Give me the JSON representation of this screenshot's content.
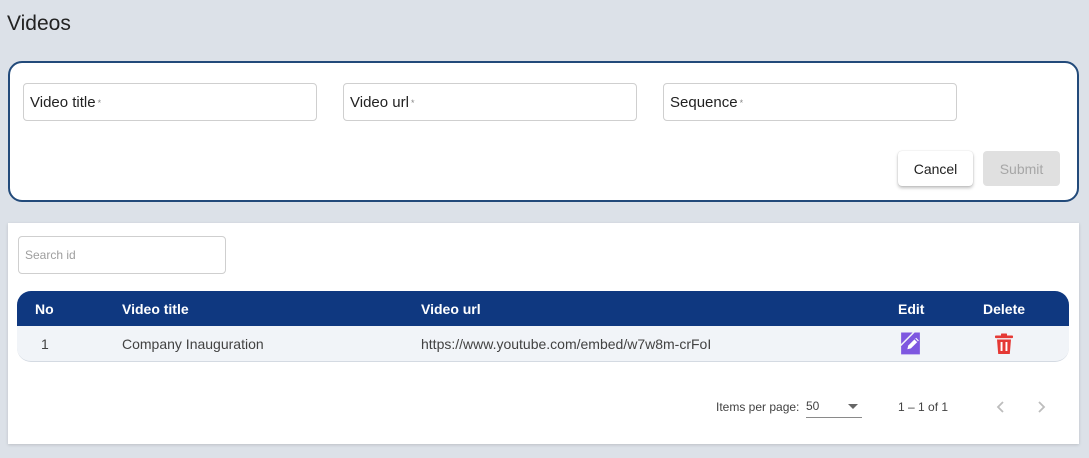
{
  "page": {
    "title": "Videos"
  },
  "form": {
    "fields": [
      {
        "label": "Video title",
        "required_mark": "*"
      },
      {
        "label": "Video url",
        "required_mark": "*"
      },
      {
        "label": "Sequence",
        "required_mark": "*"
      }
    ],
    "cancel_label": "Cancel",
    "submit_label": "Submit"
  },
  "table": {
    "search_placeholder": "Search id",
    "columns": [
      "No",
      "Video title",
      "Video url",
      "Edit",
      "Delete"
    ],
    "rows": [
      {
        "no": "1",
        "title": "Company Inauguration",
        "url": "https://www.youtube.com/embed/w7w8m-crFoI"
      }
    ],
    "icons": {
      "edit": "edit-icon",
      "delete": "trash-icon"
    },
    "colors": {
      "header": "#0f3880",
      "edit": "#7e57e0",
      "delete": "#e53935"
    }
  },
  "paginator": {
    "items_per_page_label": "Items per page:",
    "page_size": "50",
    "range_label": "1 – 1 of 1",
    "prev_icon": "chevron-left-icon",
    "next_icon": "chevron-right-icon"
  }
}
